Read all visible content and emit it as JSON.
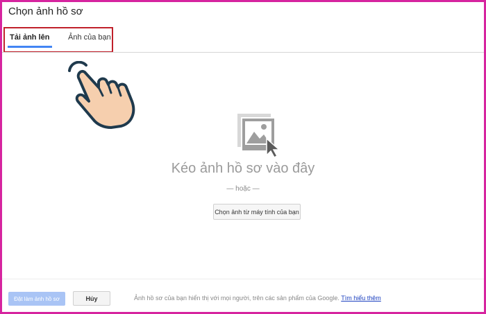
{
  "dialog": {
    "title": "Chọn ảnh hồ sơ"
  },
  "tabs": [
    {
      "label": "Tải ảnh lên",
      "active": true
    },
    {
      "label": "Ảnh của bạn",
      "active": false
    }
  ],
  "upload": {
    "drop_text": "Kéo ảnh hồ sơ vào đây",
    "or_text": "— hoặc —",
    "choose_button": "Chọn ảnh từ máy tính của bạn"
  },
  "footer": {
    "set_button": "Đặt làm ảnh hồ sơ",
    "cancel_button": "Hủy",
    "note": "Ảnh hồ sơ của bạn hiển thị với mọi người, trên các sản phẩm của Google.",
    "link": "Tìm hiểu thêm"
  },
  "colors": {
    "accent": "#4285f4",
    "highlight_border": "#c0202a",
    "frame_border": "#d6249f",
    "link": "#1a3fbf"
  },
  "icons": [
    "pointing-hand-icon",
    "image-drop-icon"
  ]
}
